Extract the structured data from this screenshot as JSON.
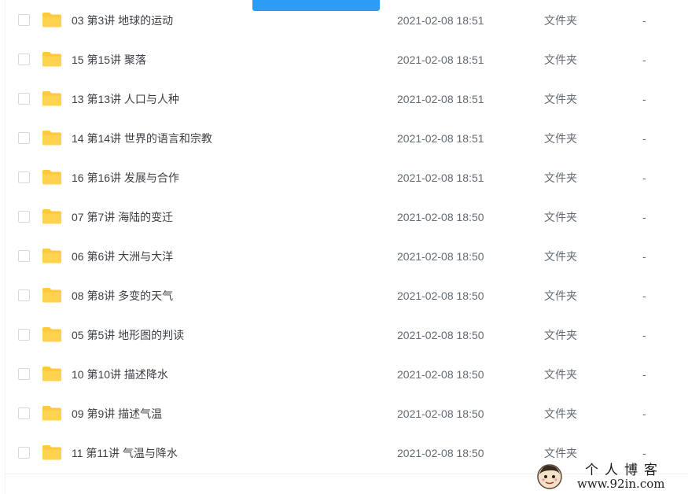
{
  "upload_button": {
    "color": "#2c9cf6"
  },
  "folder_icon": {
    "name": "folder-icon",
    "color": "#ffc83d"
  },
  "files": [
    {
      "name": "03 第3讲 地球的运动",
      "date": "2021-02-08 18:51",
      "type": "文件夹",
      "size": "-"
    },
    {
      "name": "15 第15讲 聚落",
      "date": "2021-02-08 18:51",
      "type": "文件夹",
      "size": "-"
    },
    {
      "name": "13 第13讲 人口与人种",
      "date": "2021-02-08 18:51",
      "type": "文件夹",
      "size": "-"
    },
    {
      "name": "14 第14讲 世界的语言和宗教",
      "date": "2021-02-08 18:51",
      "type": "文件夹",
      "size": "-"
    },
    {
      "name": "16 第16讲 发展与合作",
      "date": "2021-02-08 18:51",
      "type": "文件夹",
      "size": "-"
    },
    {
      "name": "07 第7讲 海陆的变迁",
      "date": "2021-02-08 18:50",
      "type": "文件夹",
      "size": "-"
    },
    {
      "name": "06 第6讲 大洲与大洋",
      "date": "2021-02-08 18:50",
      "type": "文件夹",
      "size": "-"
    },
    {
      "name": "08 第8讲 多变的天气",
      "date": "2021-02-08 18:50",
      "type": "文件夹",
      "size": "-"
    },
    {
      "name": "05 第5讲 地形图的判读",
      "date": "2021-02-08 18:50",
      "type": "文件夹",
      "size": "-"
    },
    {
      "name": "10 第10讲 描述降水",
      "date": "2021-02-08 18:50",
      "type": "文件夹",
      "size": "-"
    },
    {
      "name": "09 第9讲 描述气温",
      "date": "2021-02-08 18:50",
      "type": "文件夹",
      "size": "-"
    },
    {
      "name": "11 第11讲 气温与降水",
      "date": "2021-02-08 18:50",
      "type": "文件夹",
      "size": "-"
    }
  ],
  "watermark": {
    "title": "个人博客",
    "url": "www.92in.com"
  }
}
